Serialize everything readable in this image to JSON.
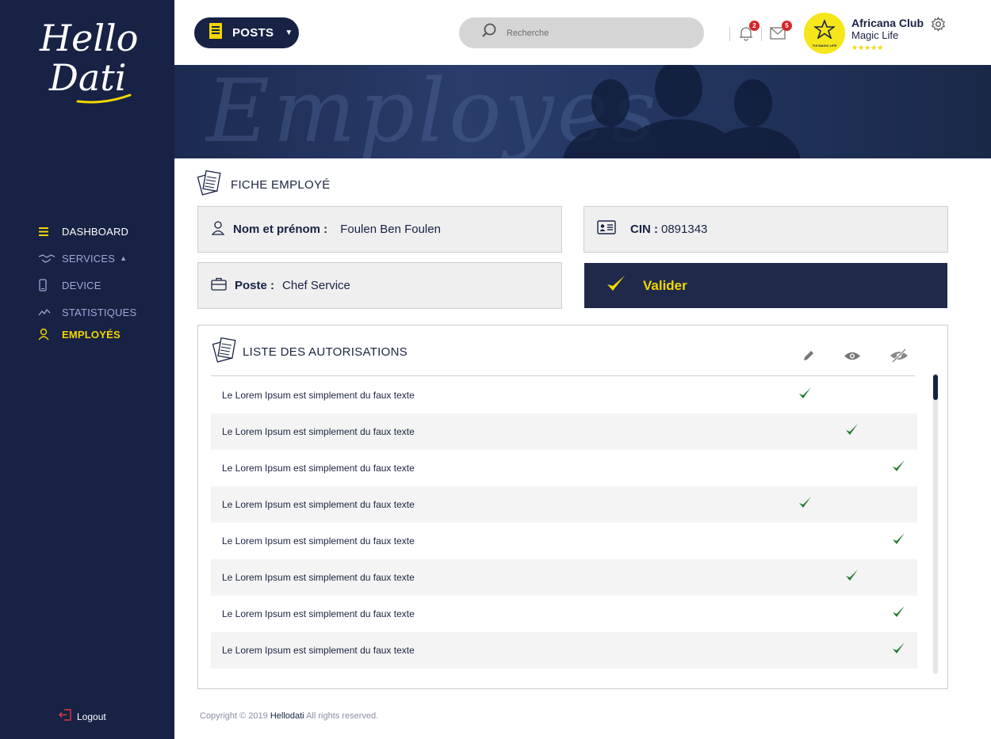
{
  "brand": {
    "logo_line1": "Hello",
    "logo_line2": "Dati"
  },
  "sidebar": {
    "items": [
      {
        "label": "DASHBOARD"
      },
      {
        "label": "SERVICES"
      },
      {
        "label": "DEVICE"
      },
      {
        "label": "STATISTIQUES"
      },
      {
        "label": "EMPLOYÉS"
      }
    ],
    "logout_label": "Logout"
  },
  "header": {
    "posts_label": "POSTS",
    "search_placeholder": "Recherche",
    "notifications_count": "2",
    "messages_count": "5",
    "club_name": "Africana Club",
    "club_subtitle": "Magic Life",
    "club_rating_stars": "★★★★★",
    "avatar_text": "TUI MAGIC LIFE"
  },
  "banner": {
    "title": "Employes"
  },
  "fiche": {
    "title": "FICHE EMPLOYÉ",
    "name_label": "Nom et prénom :",
    "name_value": "Foulen Ben Foulen",
    "cin_label": "CIN :",
    "cin_value": "0891343",
    "poste_label": "Poste :",
    "poste_value": "Chef Service",
    "validate_label": "Valider"
  },
  "autorisations": {
    "title": "LISTE DES AUTORISATIONS",
    "columns": [
      "edit-icon",
      "eye-icon",
      "eye-off-icon"
    ],
    "rows": [
      {
        "text": "Le Lorem Ipsum est simplement du faux texte",
        "column": "edit"
      },
      {
        "text": "Le Lorem Ipsum est simplement du faux texte",
        "column": "view"
      },
      {
        "text": "Le Lorem Ipsum est simplement du faux texte",
        "column": "hide"
      },
      {
        "text": "Le Lorem Ipsum est simplement du faux texte",
        "column": "edit"
      },
      {
        "text": "Le Lorem Ipsum est simplement du faux texte",
        "column": "hide"
      },
      {
        "text": "Le Lorem Ipsum est simplement du faux texte",
        "column": "view"
      },
      {
        "text": "Le Lorem Ipsum est simplement du faux texte",
        "column": "hide"
      },
      {
        "text": "Le Lorem Ipsum est simplement du faux texte",
        "column": "hide"
      }
    ]
  },
  "footer": {
    "prefix": "Copyright © 2019",
    "brand": "Hellodati",
    "suffix": "All rights reserved."
  },
  "colors": {
    "navy": "#172245",
    "accent_yellow": "#f3d700",
    "check_green": "#1f7a2e",
    "badge_red": "#d8232a"
  }
}
